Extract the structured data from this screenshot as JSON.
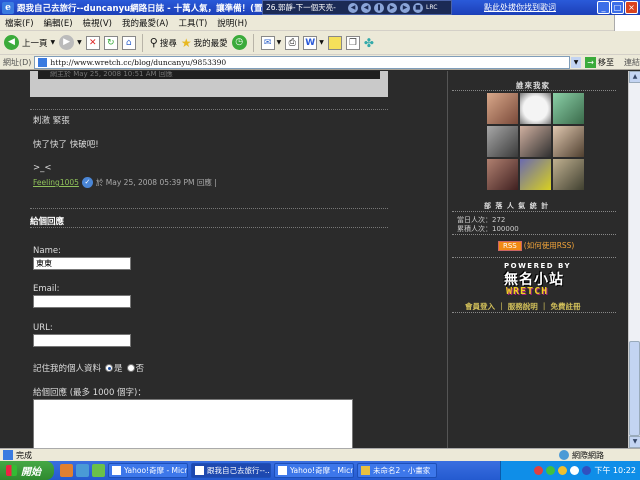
{
  "window": {
    "title": "跟我自己去旅行--duncanyu網路日誌 - 十萬人氣，讓準備！(置頂至8/...",
    "media_track": "26.郭靜-下一個天亮-",
    "media_lrc": "LRC",
    "search_banner": "點此处拔你找到歌词"
  },
  "menu": [
    "檔案(F)",
    "編輯(E)",
    "檢視(V)",
    "我的最愛(A)",
    "工具(T)",
    "說明(H)"
  ],
  "toolbar": {
    "back": "上一頁",
    "search": "搜尋",
    "favorites": "我的最愛"
  },
  "address": {
    "label": "網址(D)",
    "url": "http://www.wretch.cc/blog/duncanyu/9853390",
    "go": "移至",
    "links": "連結"
  },
  "post": {
    "prev_meta": "網主於 May 25, 2008 10:51 AM 回應",
    "line1": "刺激 緊張",
    "line2": "快了快了 快破吧!",
    "line3": ">_<",
    "commenter": "Feeling1005",
    "comment_meta": "於 May 25, 2008 05:39 PM 回應 |"
  },
  "form": {
    "section_title": "給個回應",
    "name_label": "Name:",
    "name_value": "東東",
    "email_label": "Email:",
    "url_label": "URL:",
    "remember_label": "記住我的個人資料",
    "yes": "是",
    "no": "否",
    "comment_label": "給個回應 (最多 1000 個字)："
  },
  "sidebar": {
    "visitors_title": "誰來我家",
    "stats_title": "部 落 人 氣 統 計",
    "today": "當日人次：272",
    "total": "累積人次：100000",
    "rss_btn": "RSS",
    "rss_help": "(如何使用RSS)",
    "powered": "POWERED BY",
    "logo_cn": "無名小站",
    "logo_en": "WRETCH",
    "links": "會員登入 ｜ 服務說明 ｜ 免費註冊"
  },
  "status": {
    "text": "完成",
    "zone": "網際網路"
  },
  "taskbar": {
    "start": "開始",
    "tasks": [
      "Yahoo!奇摩 - Micr...",
      "跟我自己去旅行--...",
      "Yahoo!奇摩 - Micr...",
      "未命名2 - 小畫家"
    ],
    "clock": "下午 10:22"
  },
  "colors": {
    "page_bg": "#2b2b2b",
    "link_green": "#8fc15a",
    "accent_orange": "#f28a14"
  }
}
